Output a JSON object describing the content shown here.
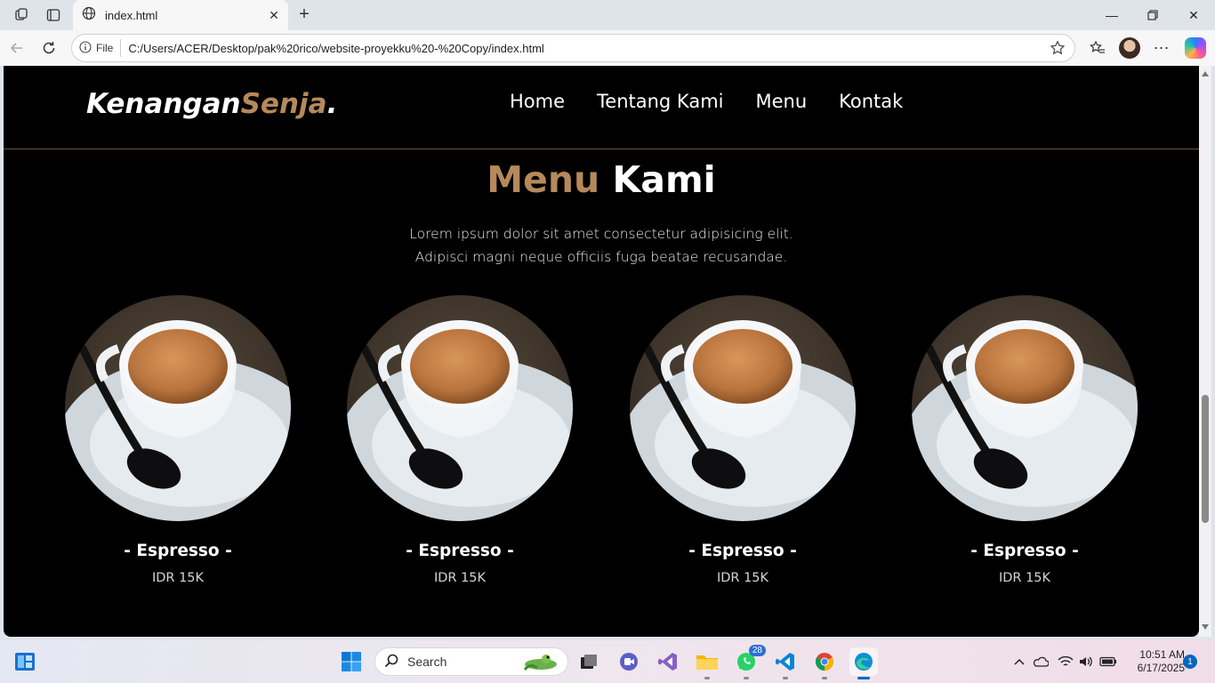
{
  "browser": {
    "tab_title": "index.html",
    "address_chip": "File",
    "url": "C:/Users/ACER/Desktop/pak%20rico/website-proyekku%20-%20Copy/index.html"
  },
  "site": {
    "logo_main": "Kenangan",
    "logo_accent": "Senja",
    "logo_dot": ".",
    "nav": [
      "Home",
      "Tentang Kami",
      "Menu",
      "Kontak"
    ],
    "title_accent": "Menu",
    "title_main": "Kami",
    "desc_line1": "Lorem ipsum dolor sit amet consectetur adipisicing elit.",
    "desc_line2": "Adipisci magni neque officiis fuga beatae recusandae.",
    "items": [
      {
        "name": "- Espresso -",
        "price": "IDR 15K"
      },
      {
        "name": "- Espresso -",
        "price": "IDR 15K"
      },
      {
        "name": "- Espresso -",
        "price": "IDR 15K"
      },
      {
        "name": "- Espresso -",
        "price": "IDR 15K"
      }
    ],
    "colors": {
      "accent": "#b6895b",
      "background": "#000000"
    }
  },
  "taskbar": {
    "search_placeholder": "Search",
    "whatsapp_badge": "28",
    "time": "10:51 AM",
    "date": "6/17/2025",
    "notifications": "1"
  }
}
